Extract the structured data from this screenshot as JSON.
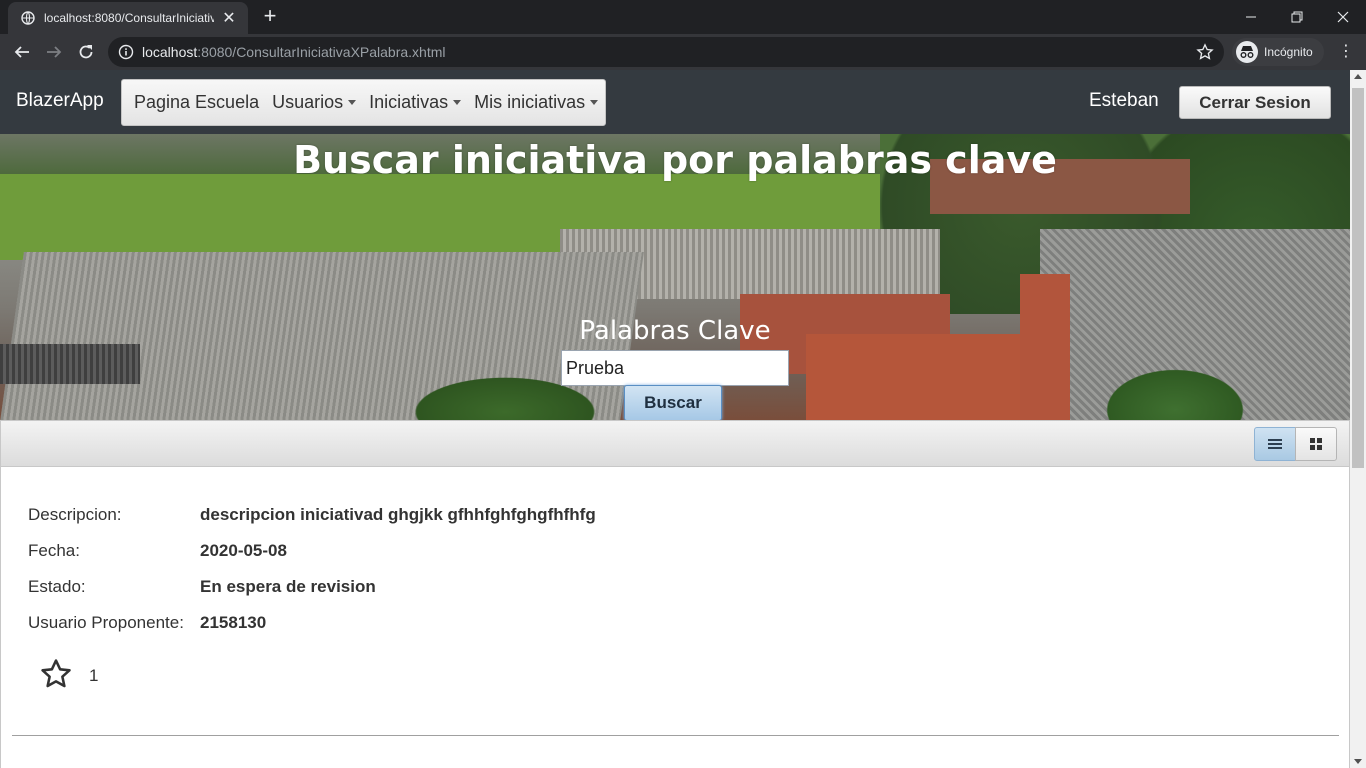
{
  "browser": {
    "tab_title": "localhost:8080/ConsultarIniciativ",
    "url_host": "localhost",
    "url_rest": ":8080/ConsultarIniciativaXPalabra.xhtml",
    "incognito_label": "Incógnito"
  },
  "nav": {
    "brand": "BlazerApp",
    "menu": [
      {
        "label": "Pagina Escuela"
      },
      {
        "label": "Usuarios"
      },
      {
        "label": "Iniciativas"
      },
      {
        "label": "Mis iniciativas"
      }
    ],
    "user": "Esteban",
    "logout_label": "Cerrar Sesion"
  },
  "hero": {
    "title": "Buscar iniciativa por palabras clave",
    "keywords_label": "Palabras Clave",
    "keywords_value": "Prueba",
    "search_label": "Buscar"
  },
  "result": {
    "fields": [
      {
        "label": "Descripcion:",
        "value": "descripcion iniciativad ghgjkk gfhhfghfghgfhfhfg"
      },
      {
        "label": "Fecha:",
        "value": "2020-05-08"
      },
      {
        "label": "Estado:",
        "value": "En espera de revision"
      },
      {
        "label": "Usuario Proponente:",
        "value": "2158130"
      }
    ],
    "votes": "1"
  },
  "colors": {
    "navbar": "#343a40",
    "accent_button": "#a6c8e6"
  }
}
